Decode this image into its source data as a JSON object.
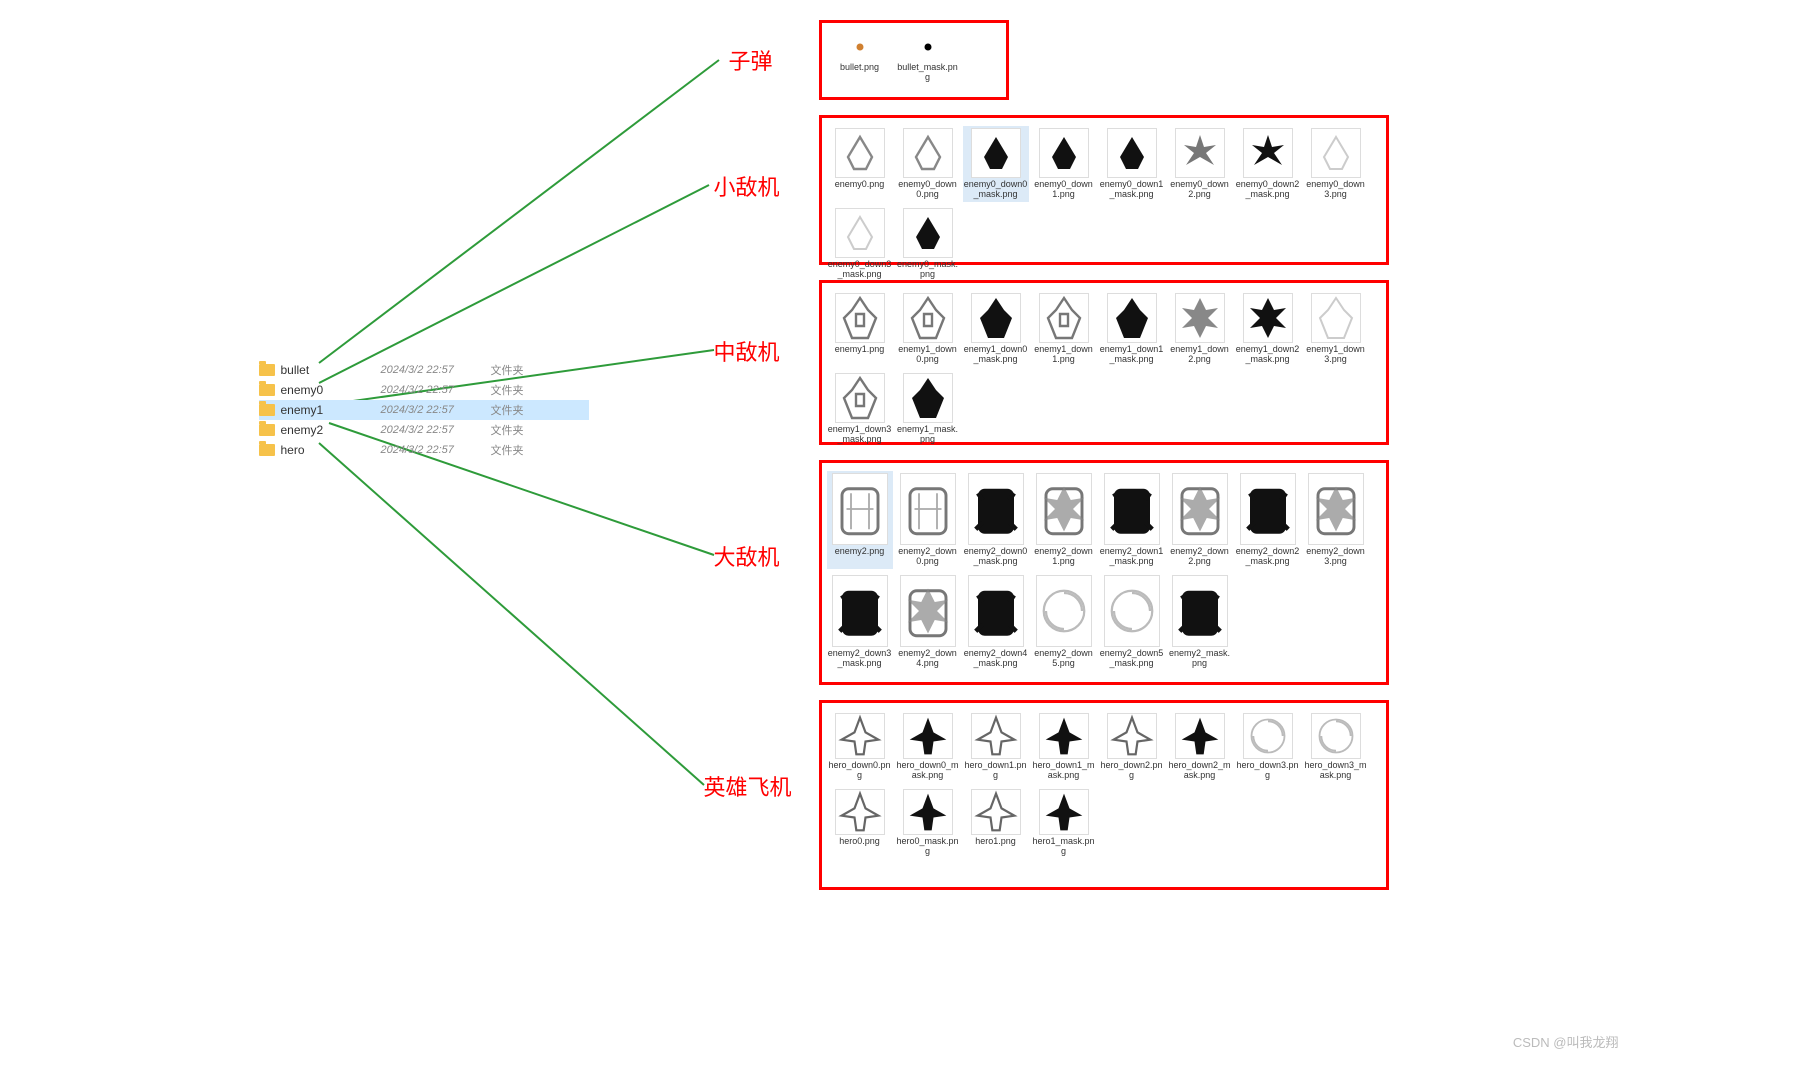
{
  "folders": [
    {
      "name": "bullet",
      "date": "2024/3/2 22:57",
      "type": "文件夹",
      "selected": false
    },
    {
      "name": "enemy0",
      "date": "2024/3/2 22:57",
      "type": "文件夹",
      "selected": false
    },
    {
      "name": "enemy1",
      "date": "2024/3/2 22:57",
      "type": "文件夹",
      "selected": true
    },
    {
      "name": "enemy2",
      "date": "2024/3/2 22:57",
      "type": "文件夹",
      "selected": false
    },
    {
      "name": "hero",
      "date": "2024/3/2 22:57",
      "type": "文件夹",
      "selected": false
    }
  ],
  "labels": {
    "bullet": "子弹",
    "smallEnemy": "小敌机",
    "midEnemy": "中敌机",
    "bigEnemy": "大敌机",
    "hero": "英雄飞机"
  },
  "panels": {
    "bullet": [
      {
        "name": "bullet.png",
        "sp": "dot-orange"
      },
      {
        "name": "bullet_mask.png",
        "sp": "dot-black"
      }
    ],
    "enemy0": [
      {
        "name": "enemy0.png",
        "sp": "small-outline"
      },
      {
        "name": "enemy0_down0.png",
        "sp": "small-outline"
      },
      {
        "name": "enemy0_down0_mask.png",
        "sp": "small-solid",
        "selected": true
      },
      {
        "name": "enemy0_down1.png",
        "sp": "small-solid"
      },
      {
        "name": "enemy0_down1_mask.png",
        "sp": "small-solid"
      },
      {
        "name": "enemy0_down2.png",
        "sp": "small-burst"
      },
      {
        "name": "enemy0_down2_mask.png",
        "sp": "small-burst-solid"
      },
      {
        "name": "enemy0_down3.png",
        "sp": "small-faint"
      },
      {
        "name": "enemy0_down3_mask.png",
        "sp": "small-faint"
      },
      {
        "name": "enemy0_mask.png",
        "sp": "small-solid"
      }
    ],
    "enemy1": [
      {
        "name": "enemy1.png",
        "sp": "mid-outline"
      },
      {
        "name": "enemy1_down0.png",
        "sp": "mid-outline"
      },
      {
        "name": "enemy1_down0_mask.png",
        "sp": "mid-solid"
      },
      {
        "name": "enemy1_down1.png",
        "sp": "mid-outline"
      },
      {
        "name": "enemy1_down1_mask.png",
        "sp": "mid-solid"
      },
      {
        "name": "enemy1_down2.png",
        "sp": "mid-burst"
      },
      {
        "name": "enemy1_down2_mask.png",
        "sp": "mid-burst-solid"
      },
      {
        "name": "enemy1_down3.png",
        "sp": "mid-faint"
      },
      {
        "name": "enemy1_down3_mask.png",
        "sp": "mid-outline"
      },
      {
        "name": "enemy1_mask.png",
        "sp": "mid-solid"
      }
    ],
    "enemy2": [
      {
        "name": "enemy2.png",
        "sp": "big-outline",
        "selected": true
      },
      {
        "name": "enemy2_down0.png",
        "sp": "big-outline"
      },
      {
        "name": "enemy2_down0_mask.png",
        "sp": "big-solid"
      },
      {
        "name": "enemy2_down1.png",
        "sp": "big-burst"
      },
      {
        "name": "enemy2_down1_mask.png",
        "sp": "big-solid"
      },
      {
        "name": "enemy2_down2.png",
        "sp": "big-burst"
      },
      {
        "name": "enemy2_down2_mask.png",
        "sp": "big-solid"
      },
      {
        "name": "enemy2_down3.png",
        "sp": "big-burst"
      },
      {
        "name": "enemy2_down3_mask.png",
        "sp": "big-solid"
      },
      {
        "name": "enemy2_down4.png",
        "sp": "big-burst"
      },
      {
        "name": "enemy2_down4_mask.png",
        "sp": "big-solid"
      },
      {
        "name": "enemy2_down5.png",
        "sp": "swirl-outline"
      },
      {
        "name": "enemy2_down5_mask.png",
        "sp": "swirl-outline"
      },
      {
        "name": "enemy2_mask.png",
        "sp": "big-solid"
      }
    ],
    "hero": [
      {
        "name": "hero_down0.png",
        "sp": "hero-outline"
      },
      {
        "name": "hero_down0_mask.png",
        "sp": "hero-solid"
      },
      {
        "name": "hero_down1.png",
        "sp": "hero-outline"
      },
      {
        "name": "hero_down1_mask.png",
        "sp": "hero-solid"
      },
      {
        "name": "hero_down2.png",
        "sp": "hero-outline"
      },
      {
        "name": "hero_down2_mask.png",
        "sp": "hero-solid"
      },
      {
        "name": "hero_down3.png",
        "sp": "swirl-outline"
      },
      {
        "name": "hero_down3_mask.png",
        "sp": "swirl-outline"
      },
      {
        "name": "hero0.png",
        "sp": "hero-outline"
      },
      {
        "name": "hero0_mask.png",
        "sp": "hero-solid"
      },
      {
        "name": "hero1.png",
        "sp": "hero-outline"
      },
      {
        "name": "hero1_mask.png",
        "sp": "hero-solid"
      }
    ]
  },
  "watermark": "CSDN @叫我龙翔"
}
